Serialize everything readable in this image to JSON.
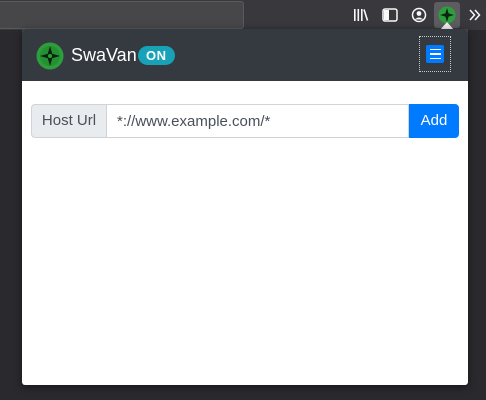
{
  "browser": {
    "toolbar_icons": [
      "library-icon",
      "sidebar-icon",
      "account-icon",
      "swavan-extension-icon",
      "overflow-chevron-icon"
    ]
  },
  "popup": {
    "brand": "SwaVan",
    "status_badge": "ON",
    "colors": {
      "header_bg": "#343a40",
      "badge_bg": "#17a2b8",
      "primary": "#007bff",
      "logo_green": "#2e9e3c"
    },
    "host_form": {
      "label": "Host Url",
      "input_value": "*://www.example.com/*",
      "add_label": "Add"
    }
  }
}
